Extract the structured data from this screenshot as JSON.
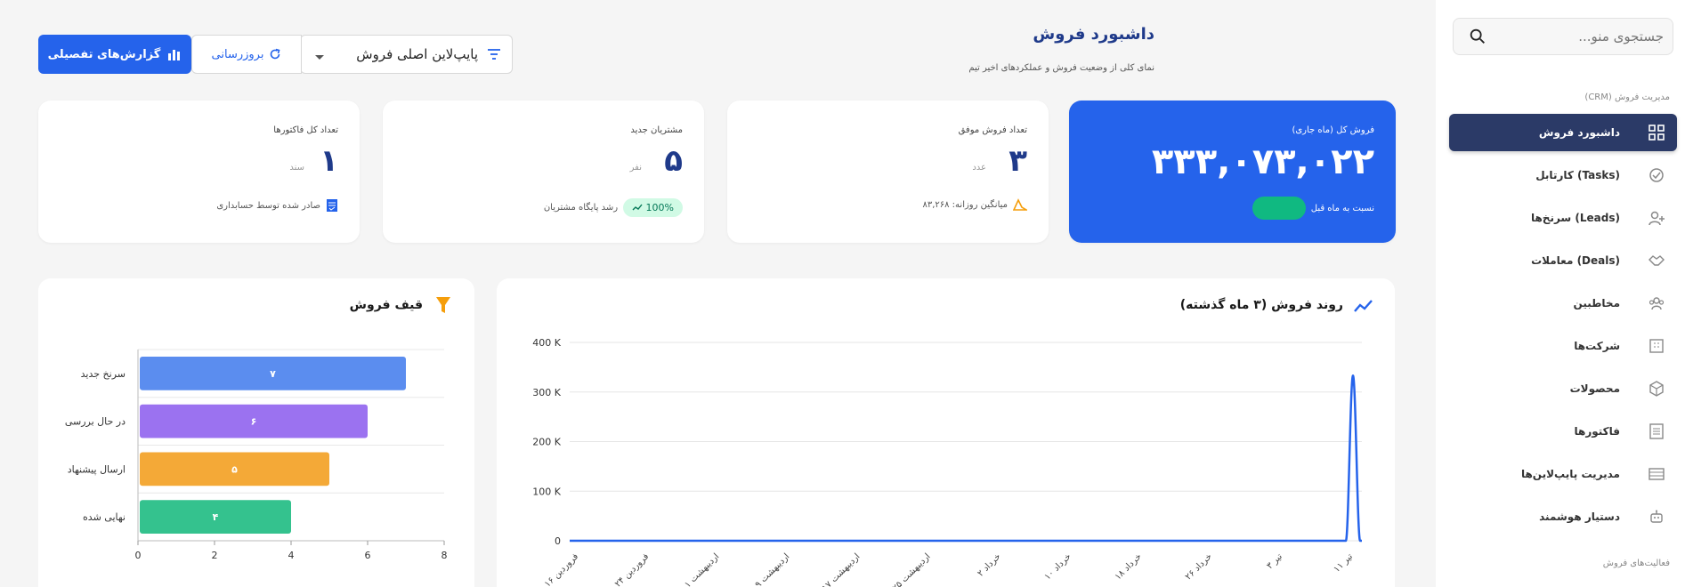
{
  "sidebar": {
    "search_placeholder": "جستجوی منو...",
    "section_crm": "مدیریت فروش (CRM)",
    "section_sales": "فعالیت‌های فروش",
    "items": [
      {
        "label": "داشبورد فروش",
        "icon": "dashboard-icon"
      },
      {
        "label": "کارتابل (Tasks)",
        "icon": "check-circle-icon"
      },
      {
        "label": "سرنخ‌ها (Leads)",
        "icon": "user-plus-icon"
      },
      {
        "label": "معاملات (Deals)",
        "icon": "handshake-icon"
      },
      {
        "label": "مخاطبین",
        "icon": "users-icon"
      },
      {
        "label": "شرکت‌ها",
        "icon": "building-icon"
      },
      {
        "label": "محصولات",
        "icon": "box-icon"
      },
      {
        "label": "فاکتورها",
        "icon": "invoice-icon"
      },
      {
        "label": "مدیریت پایپ‌لاین‌ها",
        "icon": "pipeline-icon"
      },
      {
        "label": "دستیار هوشمند",
        "icon": "robot-icon"
      }
    ]
  },
  "header": {
    "title": "داشبورد فروش",
    "subtitle": "نمای کلی از وضعیت فروش و عملکردهای اخیر تیم",
    "pipeline_select": "پایپ‌لاین اصلی فروش",
    "refresh_label": "بروزرسانی",
    "report_label": "گزارش‌های تفصیلی"
  },
  "kpis": {
    "total_sales": {
      "label": "فروش کل (ماه جاری)",
      "value": "۳۳۳,۰۷۳,۰۲۲",
      "foot": "نسبت به ماه قبل"
    },
    "won_count": {
      "label": "تعداد فروش موفق",
      "value": "۳",
      "unit": "عدد",
      "foot": "میانگین روزانه: ۸۳,۲۶۸"
    },
    "new_customers": {
      "label": "مشتریان جدید",
      "value": "۵",
      "unit": "نفر",
      "pill": "100%",
      "foot": "رشد پایگاه مشتریان"
    },
    "invoices": {
      "label": "تعداد کل فاکتورها",
      "value": "۱",
      "unit": "سند",
      "foot": "صادر شده توسط حسابداری"
    }
  },
  "trend_panel": {
    "title": "روند فروش (۳ ماه گذشته)"
  },
  "funnel_panel": {
    "title": "قیف فروش"
  },
  "colors": {
    "primary": "#2563eb",
    "navy": "#2b3a67",
    "green": "#10b981",
    "funnel": [
      "#5b8def",
      "#9b72f0",
      "#f4a937",
      "#34c28e"
    ]
  },
  "chart_data": [
    {
      "type": "line",
      "title": "روند فروش (۳ ماه گذشته)",
      "x": [
        "۱۶ فروردین",
        "۲۴ فروردین",
        "۱ اردیبهشت",
        "۹ اردیبهشت",
        "۱۷ اردیبهشت",
        "۲۵ اردیبهشت",
        "۲ خرداد",
        "۱۰ خرداد",
        "۱۸ خرداد",
        "۲۶ خرداد",
        "۳ تیر",
        "۱۱ تیر"
      ],
      "series": [
        {
          "values": [
            0,
            0,
            0,
            0,
            0,
            0,
            0,
            0,
            0,
            0,
            0,
            333073
          ]
        }
      ],
      "yticks": [
        "0",
        "100 K",
        "200 K",
        "300 K",
        "400 K"
      ],
      "ylim": [
        0,
        400000
      ],
      "grid": true
    },
    {
      "type": "bar",
      "orientation": "horizontal",
      "title": "قیف فروش",
      "categories": [
        "سرنخ جدید",
        "در حال بررسی",
        "ارسال پیشنهاد",
        "نهایی شده"
      ],
      "values": [
        7,
        6,
        5,
        4
      ],
      "value_labels": [
        "۷",
        "۶",
        "۵",
        "۴"
      ],
      "xticks": [
        "0",
        "2",
        "4",
        "6",
        "8"
      ],
      "xlim": [
        0,
        8
      ]
    }
  ]
}
